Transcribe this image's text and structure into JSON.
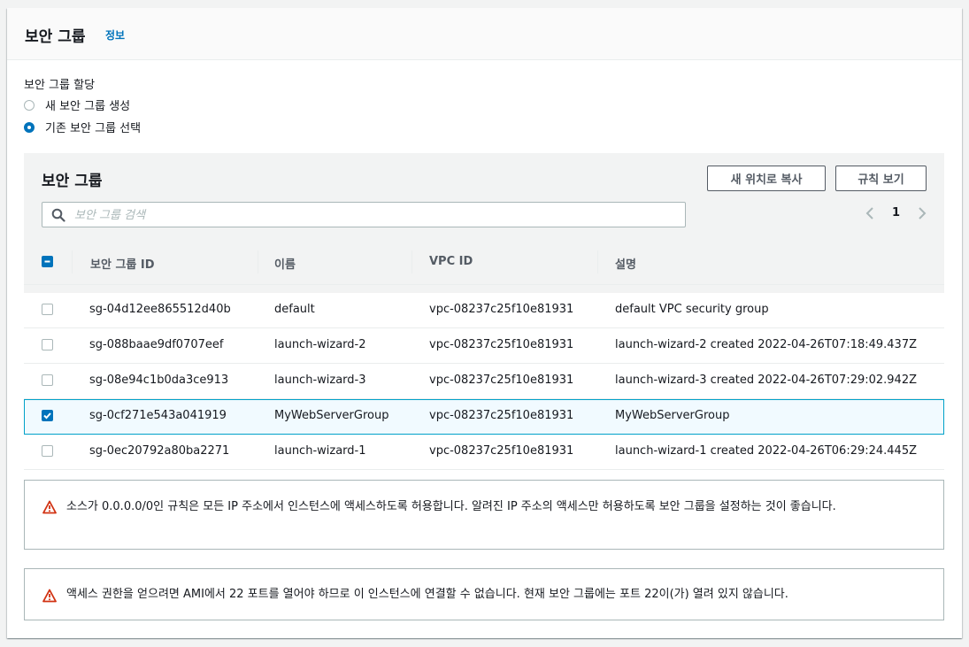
{
  "header": {
    "title": "보안 그룹",
    "info": "정보"
  },
  "assignment": {
    "label": "보안 그룹 할당",
    "options": [
      {
        "label": "새 보안 그룹 생성",
        "selected": false
      },
      {
        "label": "기존 보안 그룹 선택",
        "selected": true
      }
    ]
  },
  "groups_panel": {
    "title": "보안 그룹",
    "copy_button": "새 위치로 복사",
    "rules_button": "규칙 보기",
    "search_placeholder": "보안 그룹 검색",
    "page": "1"
  },
  "table": {
    "columns": [
      "보안 그룹 ID",
      "이름",
      "VPC ID",
      "설명"
    ],
    "rows": [
      {
        "id": "sg-04d12ee865512d40b",
        "name": "default",
        "vpc": "vpc-08237c25f10e81931",
        "desc": "default VPC security group",
        "checked": false
      },
      {
        "id": "sg-088baae9df0707eef",
        "name": "launch-wizard-2",
        "vpc": "vpc-08237c25f10e81931",
        "desc": "launch-wizard-2 created 2022-04-26T07:18:49.437Z",
        "checked": false
      },
      {
        "id": "sg-08e94c1b0da3ce913",
        "name": "launch-wizard-3",
        "vpc": "vpc-08237c25f10e81931",
        "desc": "launch-wizard-3 created 2022-04-26T07:29:02.942Z",
        "checked": false
      },
      {
        "id": "sg-0cf271e543a041919",
        "name": "MyWebServerGroup",
        "vpc": "vpc-08237c25f10e81931",
        "desc": "MyWebServerGroup",
        "checked": true
      },
      {
        "id": "sg-0ec20792a80ba2271",
        "name": "launch-wizard-1",
        "vpc": "vpc-08237c25f10e81931",
        "desc": "launch-wizard-1 created 2022-04-26T06:29:24.445Z",
        "checked": false
      }
    ]
  },
  "alerts": [
    {
      "icon": "warning-icon",
      "text": "소스가 0.0.0.0/0인 규칙은 모든 IP 주소에서 인스턴스에 액세스하도록 허용합니다. 알려진 IP 주소의 액세스만 허용하도록 보안 그룹을 설정하는 것이 좋습니다."
    },
    {
      "icon": "warning-icon",
      "text": "액세스 권한을 얻으려면 AMI에서 22 포트를 열어야 하므로 이 인스턴스에 연결할 수 없습니다. 현재 보안 그룹에는 포트 22이(가) 열려 있지 않습니다."
    }
  ],
  "colors": {
    "accent": "#0073bb",
    "warning": "#d13212",
    "selected_border": "#00a1c9"
  }
}
